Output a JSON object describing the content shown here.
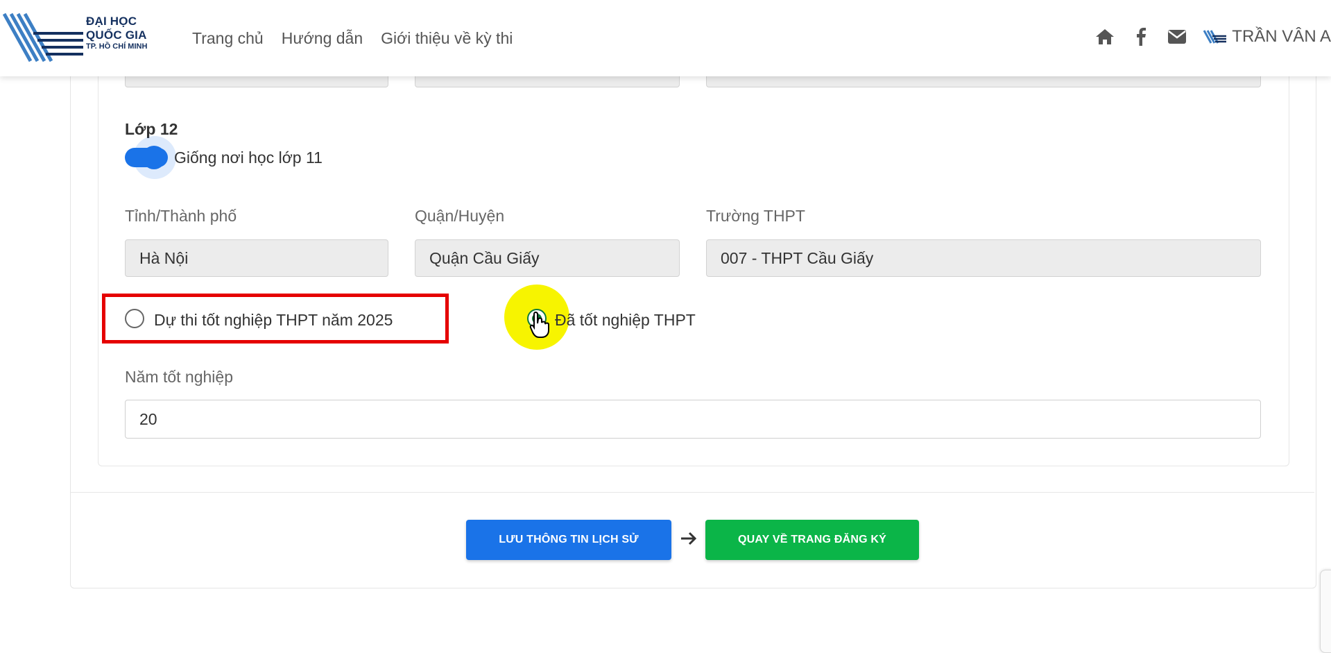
{
  "header": {
    "logo": {
      "line1": "ĐẠI HỌC",
      "line2": "QUỐC GIA",
      "line3": "TP. HỒ CHÍ MINH"
    },
    "nav": [
      {
        "label": "Trang chủ"
      },
      {
        "label": "Hướng dẫn"
      },
      {
        "label": "Giới thiệu về kỳ thi"
      }
    ],
    "icons": [
      "home-icon",
      "facebook-icon",
      "mail-icon"
    ],
    "user_name": "TRẦN VÂN A"
  },
  "form": {
    "section_title": "Lớp 12",
    "same_as_11": {
      "label": "Giống nơi học lớp 11",
      "checked": true
    },
    "province": {
      "label": "Tỉnh/Thành phố",
      "value": "Hà Nội"
    },
    "district": {
      "label": "Quận/Huyện",
      "value": "Quận Cầu Giấy"
    },
    "school": {
      "label": "Trường THPT",
      "value": "007 - THPT Cầu Giấy"
    },
    "status_options": [
      {
        "label": "Dự thi tốt nghiệp THPT năm 2025",
        "selected": false
      },
      {
        "label": "Đã tốt nghiệp THPT",
        "selected": true
      }
    ],
    "graduation_year": {
      "label": "Năm tốt nghiệp",
      "value": "20"
    }
  },
  "actions": {
    "save_label": "LƯU THÔNG TIN LỊCH SỬ",
    "back_label": "QUAY VỀ TRANG ĐĂNG KÝ"
  },
  "colors": {
    "primary": "#1a73e8",
    "success": "#0bb548",
    "highlight": "#e50000",
    "cursor_spot": "#f7f400"
  }
}
